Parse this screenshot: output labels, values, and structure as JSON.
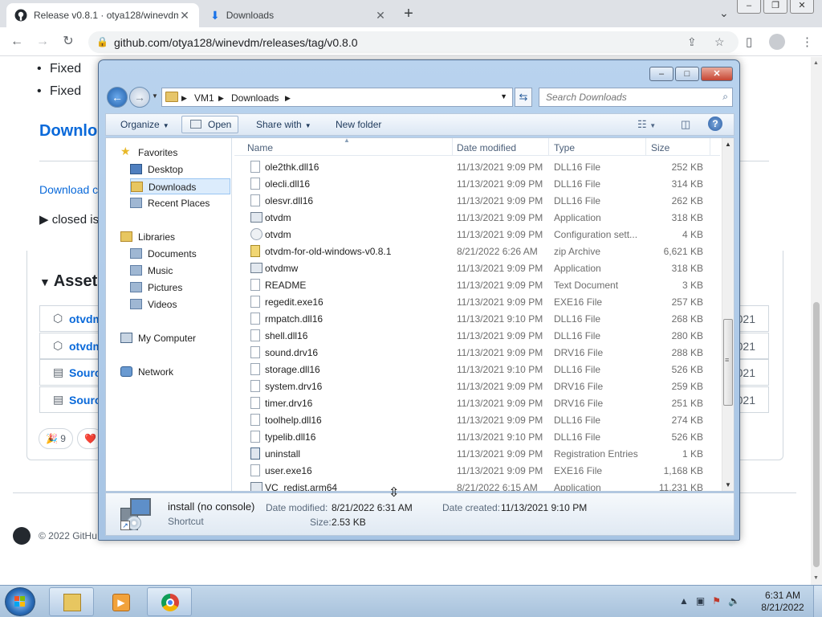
{
  "browser": {
    "tabs": [
      {
        "title": "Release v0.8.1 · otya128/winevdm",
        "active": true
      },
      {
        "title": "Downloads",
        "active": false
      }
    ],
    "url": "github.com/otya128/winevdm/releases/tag/v0.8.0"
  },
  "page": {
    "list_items": [
      "Fixed",
      "Fixed"
    ],
    "heading": "Downlo",
    "download_link": "Download c",
    "details_summary": "closed is",
    "assets_heading": "Assets",
    "assets": [
      {
        "name": "otvdm",
        "date": "021"
      },
      {
        "name": "otvdm",
        "date": "021"
      },
      {
        "name": "Sourc",
        "date": "021"
      },
      {
        "name": "Sourc",
        "date": "021"
      }
    ],
    "reactions": [
      {
        "emoji": "🎉",
        "count": "9"
      },
      {
        "emoji": "❤️",
        "count": ""
      }
    ],
    "footer": "© 2022 GitHu"
  },
  "explorer": {
    "breadcrumb": [
      "VM1",
      "Downloads"
    ],
    "search_placeholder": "Search Downloads",
    "commands": {
      "organize": "Organize",
      "open": "Open",
      "share_with": "Share with",
      "new_folder": "New folder"
    },
    "nav": {
      "favorites": "Favorites",
      "desktop": "Desktop",
      "downloads": "Downloads",
      "recent_places": "Recent Places",
      "libraries": "Libraries",
      "documents": "Documents",
      "music": "Music",
      "pictures": "Pictures",
      "videos": "Videos",
      "my_computer": "My Computer",
      "network": "Network"
    },
    "columns": {
      "name": "Name",
      "date": "Date modified",
      "type": "Type",
      "size": "Size"
    },
    "files": [
      {
        "name": "ole2thk.dll16",
        "date": "11/13/2021 9:09 PM",
        "type": "DLL16 File",
        "size": "252 KB",
        "icon": "file"
      },
      {
        "name": "olecli.dll16",
        "date": "11/13/2021 9:09 PM",
        "type": "DLL16 File",
        "size": "314 KB",
        "icon": "file"
      },
      {
        "name": "olesvr.dll16",
        "date": "11/13/2021 9:09 PM",
        "type": "DLL16 File",
        "size": "262 KB",
        "icon": "file"
      },
      {
        "name": "otvdm",
        "date": "11/13/2021 9:09 PM",
        "type": "Application",
        "size": "318 KB",
        "icon": "app"
      },
      {
        "name": "otvdm",
        "date": "11/13/2021 9:09 PM",
        "type": "Configuration sett...",
        "size": "4 KB",
        "icon": "cfg"
      },
      {
        "name": "otvdm-for-old-windows-v0.8.1",
        "date": "8/21/2022 6:26 AM",
        "type": "zip Archive",
        "size": "6,621 KB",
        "icon": "zip"
      },
      {
        "name": "otvdmw",
        "date": "11/13/2021 9:09 PM",
        "type": "Application",
        "size": "318 KB",
        "icon": "app"
      },
      {
        "name": "README",
        "date": "11/13/2021 9:09 PM",
        "type": "Text Document",
        "size": "3 KB",
        "icon": "file"
      },
      {
        "name": "regedit.exe16",
        "date": "11/13/2021 9:09 PM",
        "type": "EXE16 File",
        "size": "257 KB",
        "icon": "file"
      },
      {
        "name": "rmpatch.dll16",
        "date": "11/13/2021 9:10 PM",
        "type": "DLL16 File",
        "size": "268 KB",
        "icon": "file"
      },
      {
        "name": "shell.dll16",
        "date": "11/13/2021 9:09 PM",
        "type": "DLL16 File",
        "size": "280 KB",
        "icon": "file"
      },
      {
        "name": "sound.drv16",
        "date": "11/13/2021 9:09 PM",
        "type": "DRV16 File",
        "size": "288 KB",
        "icon": "file"
      },
      {
        "name": "storage.dll16",
        "date": "11/13/2021 9:10 PM",
        "type": "DLL16 File",
        "size": "526 KB",
        "icon": "file"
      },
      {
        "name": "system.drv16",
        "date": "11/13/2021 9:09 PM",
        "type": "DRV16 File",
        "size": "259 KB",
        "icon": "file"
      },
      {
        "name": "timer.drv16",
        "date": "11/13/2021 9:09 PM",
        "type": "DRV16 File",
        "size": "251 KB",
        "icon": "file"
      },
      {
        "name": "toolhelp.dll16",
        "date": "11/13/2021 9:09 PM",
        "type": "DLL16 File",
        "size": "274 KB",
        "icon": "file"
      },
      {
        "name": "typelib.dll16",
        "date": "11/13/2021 9:10 PM",
        "type": "DLL16 File",
        "size": "526 KB",
        "icon": "file"
      },
      {
        "name": "uninstall",
        "date": "11/13/2021 9:09 PM",
        "type": "Registration Entries",
        "size": "1 KB",
        "icon": "reg"
      },
      {
        "name": "user.exe16",
        "date": "11/13/2021 9:09 PM",
        "type": "EXE16 File",
        "size": "1,168 KB",
        "icon": "file"
      },
      {
        "name": "VC_redist.arm64",
        "date": "8/21/2022 6:15 AM",
        "type": "Application",
        "size": "11,231 KB",
        "icon": "app"
      }
    ],
    "details": {
      "name": "install (no console)",
      "type": "Shortcut",
      "date_modified_label": "Date modified:",
      "date_modified": "8/21/2022 6:31 AM",
      "size_label": "Size:",
      "size": "2.53 KB",
      "date_created_label": "Date created:",
      "date_created": "11/13/2021 9:10 PM"
    }
  },
  "taskbar": {
    "time": "6:31 AM",
    "date": "8/21/2022"
  }
}
